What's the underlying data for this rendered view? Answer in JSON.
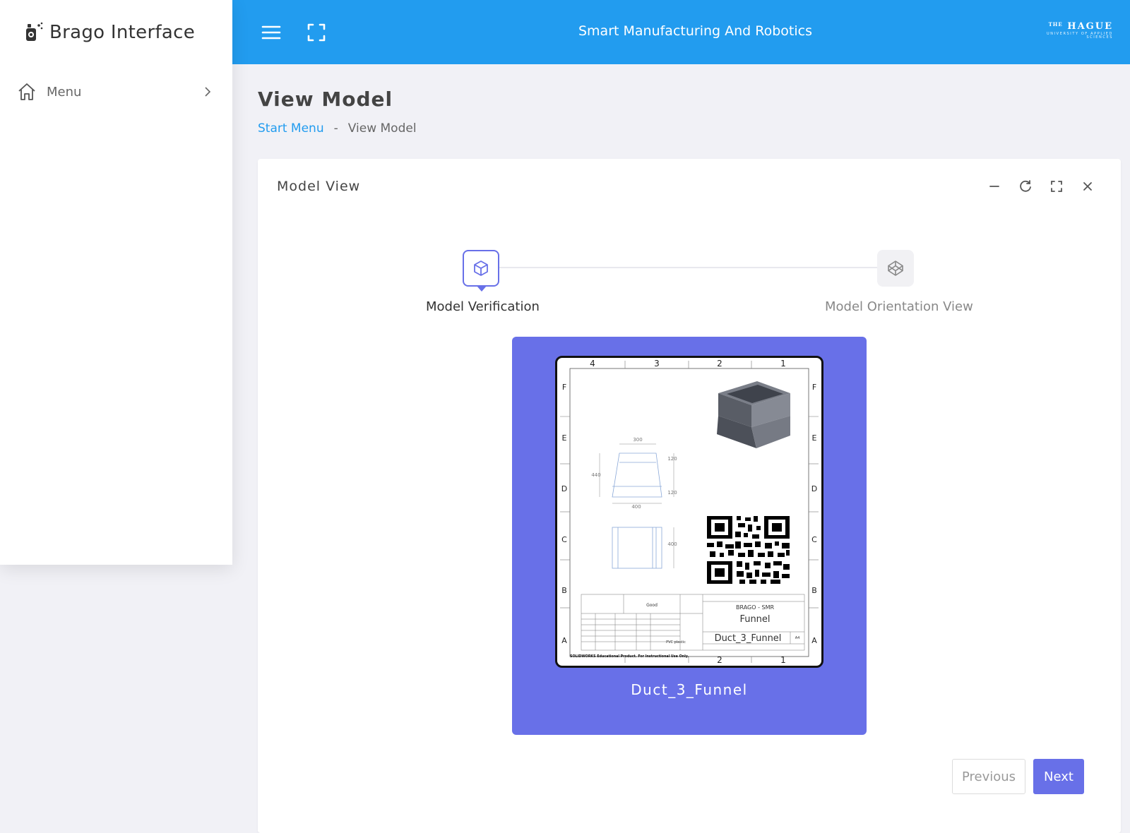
{
  "sidebar": {
    "brand": "Brago Interface",
    "items": [
      {
        "label": "Menu",
        "icon": "home-icon"
      }
    ]
  },
  "header": {
    "title": "Smart Manufacturing And Robotics",
    "logo_main": "HAGUE",
    "logo_prefix": "THE",
    "logo_sub": "UNIVERSITY OF APPLIED SCIENCES"
  },
  "page": {
    "title": "View Model",
    "breadcrumb": {
      "link": "Start Menu",
      "separator": "-",
      "current": "View Model"
    }
  },
  "card": {
    "title": "Model View",
    "tools": [
      "minimize-icon",
      "refresh-icon",
      "expand-icon",
      "close-icon"
    ]
  },
  "stepper": {
    "steps": [
      {
        "label": "Model Verification",
        "state": "active"
      },
      {
        "label": "Model Orientation View",
        "state": "inactive"
      }
    ]
  },
  "model": {
    "name": "Duct_3_Funnel",
    "drawing": {
      "col_labels": [
        "4",
        "3",
        "2",
        "1"
      ],
      "row_labels": [
        "F",
        "E",
        "D",
        "C",
        "B",
        "A"
      ],
      "dims": {
        "top_width": "300",
        "bottom_width": "400",
        "height": "440",
        "upper": "120",
        "lower": "120",
        "side": "400"
      },
      "title_block": {
        "company": "BRAGO - SMR",
        "part": "Funnel",
        "drawing_name": "Duct_3_Funnel",
        "finish": "Good",
        "material": "PVC plastic",
        "size": "A4"
      },
      "footer": "SOLIDWORKS Educational Product. For Instructional Use Only."
    }
  },
  "nav": {
    "previous": "Previous",
    "next": "Next"
  },
  "colors": {
    "header": "#229cef",
    "accent": "#6870e8",
    "link": "#229cef",
    "background": "#f1f1f6"
  }
}
